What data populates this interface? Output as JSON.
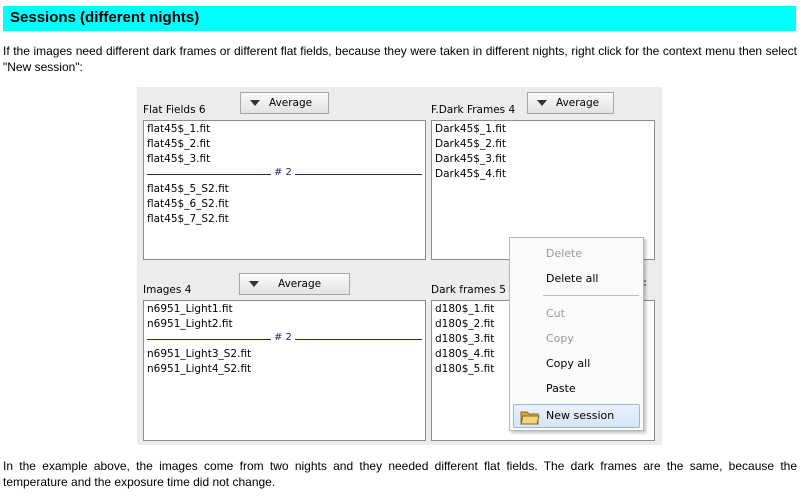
{
  "header": {
    "title": "Sessions (different nights)"
  },
  "intro_text": "If the images need different dark frames or different flat fields, because they were taken in different nights, right click for the context menu then select \"New session\":",
  "outro_text": "In the example above, the images come from two nights and they needed different flat fields. The dark frames are the same, because the temperature and the exposure time did not change.",
  "panels": {
    "flat": {
      "label": "Flat Fields 6",
      "button": "Average",
      "items_a": [
        "flat45$_1.fit",
        "flat45$_2.fit",
        "flat45$_3.fit"
      ],
      "separator": "# 2",
      "items_b": [
        "flat45$_5_S2.fit",
        "flat45$_6_S2.fit",
        "flat45$_7_S2.fit"
      ]
    },
    "fdark": {
      "label": "F.Dark Frames 4",
      "button": "Average",
      "items": [
        "Dark45$_1.fit",
        "Dark45$_2.fit",
        "Dark45$_3.fit",
        "Dark45$_4.fit"
      ]
    },
    "images": {
      "label": "Images 4",
      "button": "Average",
      "items_a": [
        "n6951_Light1.fit",
        "n6951_Light2.fit"
      ],
      "separator": "# 2",
      "items_b": [
        "n6951_Light3_S2.fit",
        "n6951_Light4_S2.fit"
      ]
    },
    "dark": {
      "label": "Dark frames 5",
      "items": [
        "d180$_1.fit",
        "d180$_2.fit",
        "d180$_3.fit",
        "d180$_4.fit",
        "d180$_5.fit"
      ]
    }
  },
  "context_menu": {
    "delete": "Delete",
    "delete_all": "Delete all",
    "cut": "Cut",
    "copy": "Copy",
    "copy_all": "Copy all",
    "paste": "Paste",
    "new_session": "New session"
  },
  "icons": [
    "dropdown-triangle-icon",
    "folder-icon",
    "resize-grip-icon"
  ],
  "colors": {
    "header_bg": "#00ffff",
    "separator": "#1e2a6e",
    "menu_highlight": "#d6e5f7"
  }
}
